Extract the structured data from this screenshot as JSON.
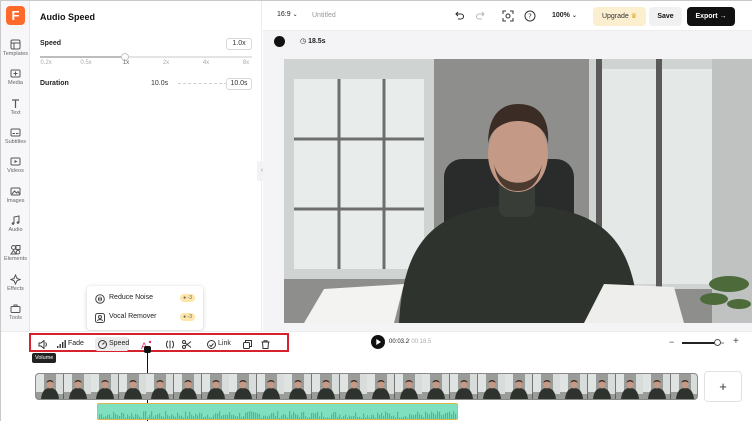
{
  "app": {
    "logo_letter": "F",
    "accent": "#ff6a2b"
  },
  "sidebar": {
    "items": [
      {
        "label": "Templates",
        "icon": "templates-icon"
      },
      {
        "label": "Media",
        "icon": "media-icon"
      },
      {
        "label": "Text",
        "icon": "text-icon"
      },
      {
        "label": "Subtitles",
        "icon": "subtitles-icon"
      },
      {
        "label": "Videos",
        "icon": "video-icon"
      },
      {
        "label": "Images",
        "icon": "image-icon"
      },
      {
        "label": "Audio",
        "icon": "audio-icon"
      },
      {
        "label": "Elements",
        "icon": "elements-icon"
      },
      {
        "label": "Effects",
        "icon": "effects-icon"
      },
      {
        "label": "Tools",
        "icon": "tools-icon"
      }
    ]
  },
  "panel": {
    "title": "Audio Speed",
    "speed": {
      "label": "Speed",
      "value": "1.0x",
      "ticks": [
        "0.2x",
        "0.5x",
        "1x",
        "2x",
        "4x",
        "8x"
      ],
      "position": 0.4
    },
    "duration": {
      "label": "Duration",
      "original": "10.0s",
      "value": "10.0s"
    }
  },
  "topbar": {
    "ratio": "16:9",
    "title": "Untitled",
    "zoom": "100%",
    "upgrade_label": "Upgrade",
    "save_label": "Save",
    "export_label": "Export"
  },
  "canvas": {
    "background_color": "#111111",
    "duration": "18.5s"
  },
  "float_menu": {
    "items": [
      {
        "label": "Reduce Noise",
        "badge": "-3"
      },
      {
        "label": "Vocal Remover",
        "badge": "-3"
      }
    ]
  },
  "toolbar": {
    "fade_label": "Fade",
    "speed_label": "Speed",
    "link_label": "Link",
    "tooltip": "Volume",
    "highlight_color": "#d6222c"
  },
  "playback": {
    "current_time": "00:03.2",
    "total_time": "/ 00:18.5",
    "zoom_level": 0.85
  },
  "timeline": {
    "add_label": "+",
    "audio_color": "#7fe0c0"
  }
}
